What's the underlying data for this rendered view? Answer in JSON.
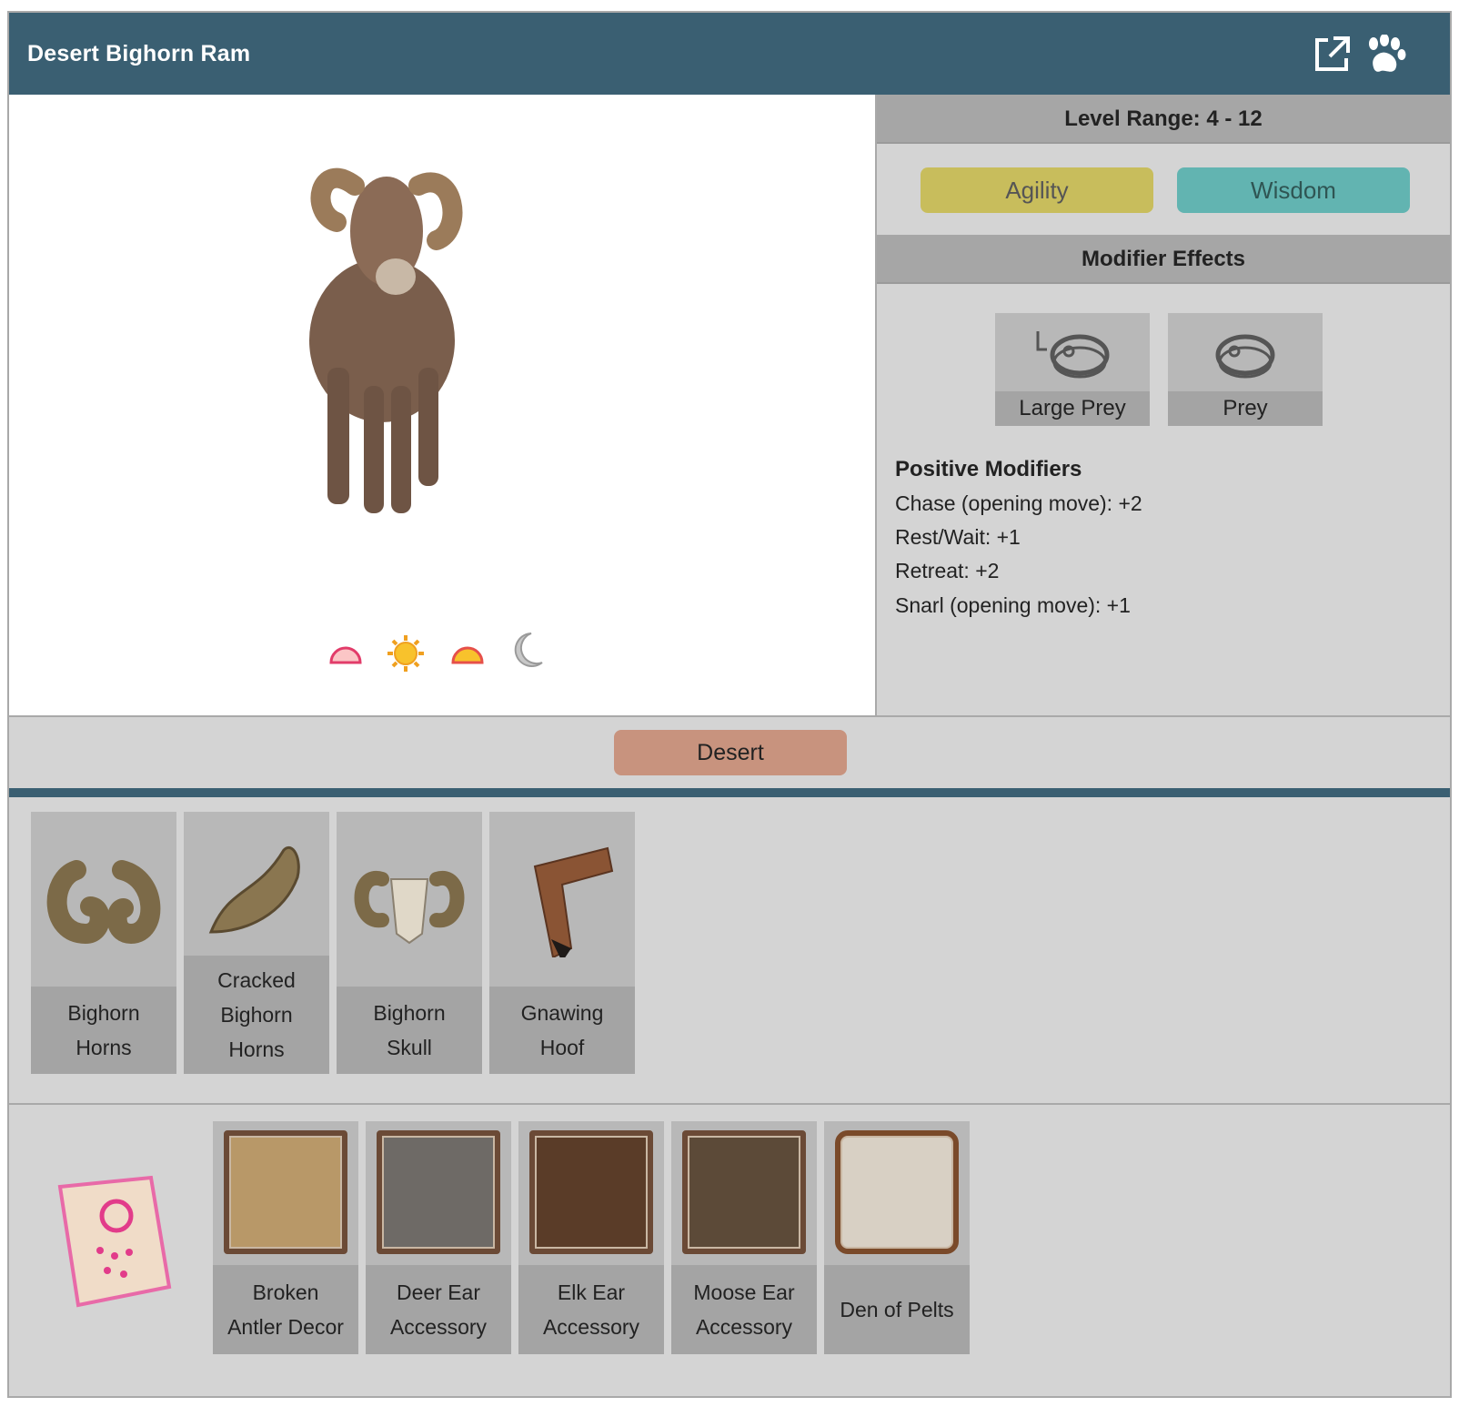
{
  "header": {
    "title": "Desert Bighorn Ram",
    "icons": [
      "external-link-icon",
      "paw-icon"
    ]
  },
  "time_of_day": [
    "dawn-icon",
    "sun-icon",
    "dusk-icon",
    "moon-icon"
  ],
  "level_range": "Level Range: 4 - 12",
  "stats": {
    "primary": "Agility",
    "secondary": "Wisdom"
  },
  "modifier_effects": {
    "heading": "Modifier Effects",
    "tags": [
      {
        "label": "Large Prey",
        "icon": "large-meat-icon"
      },
      {
        "label": "Prey",
        "icon": "meat-icon"
      }
    ],
    "positive_title": "Positive Modifiers",
    "positive": [
      "Chase (opening move): +2",
      "Rest/Wait: +1",
      "Retreat: +2",
      "Snarl (opening move): +1"
    ]
  },
  "biome": {
    "label": "Desert"
  },
  "drops": [
    {
      "line1": "Bighorn",
      "line2": "Horns",
      "line3": ""
    },
    {
      "line1": "Cracked",
      "line2": "Bighorn",
      "line3": "Horns"
    },
    {
      "line1": "Bighorn",
      "line2": "Skull",
      "line3": ""
    },
    {
      "line1": "Gnawing",
      "line2": "Hoof",
      "line3": ""
    }
  ],
  "crafts": [
    {
      "line1": "Broken",
      "line2": "Antler Decor"
    },
    {
      "line1": "Deer Ear",
      "line2": "Accessory"
    },
    {
      "line1": "Elk Ear",
      "line2": "Accessory"
    },
    {
      "line1": "Moose Ear",
      "line2": "Accessory"
    },
    {
      "line1": "Den of Pelts",
      "line2": ""
    }
  ],
  "colors": {
    "header": "#3a5f72",
    "agility": "#c8bd5c",
    "wisdom": "#62b4b1",
    "desert": "#c8937e"
  }
}
